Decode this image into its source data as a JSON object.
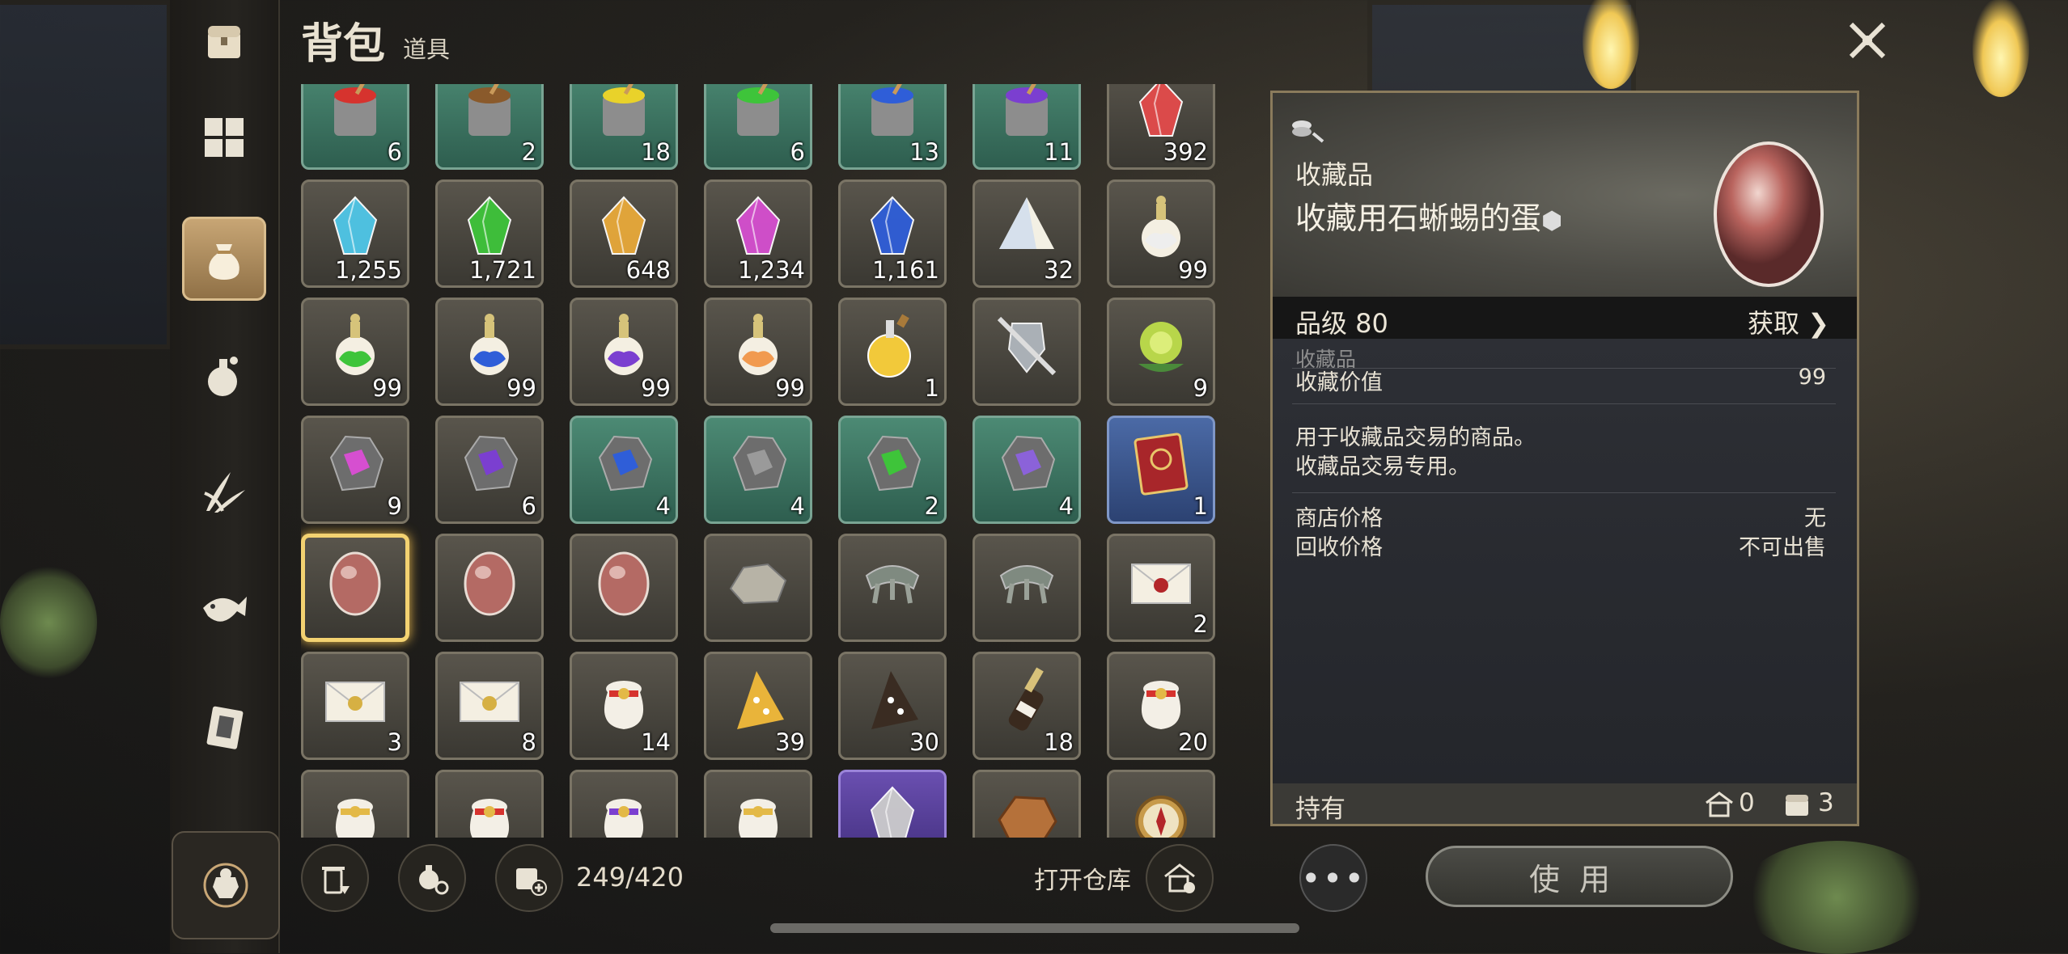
{
  "header": {
    "title": "背包",
    "subtitle": "道具"
  },
  "nav": [
    "chest-icon",
    "grid-icon",
    "bag-icon",
    "potion-icon",
    "herb-icon",
    "fish-icon",
    "book-icon",
    "armor-icon"
  ],
  "items": [
    {
      "icon": "red-paint-bucket",
      "qty": "6",
      "bg": "green"
    },
    {
      "icon": "brown-paint-bucket",
      "qty": "2",
      "bg": "green"
    },
    {
      "icon": "yellow-paint-bucket",
      "qty": "18",
      "bg": "green"
    },
    {
      "icon": "green-paint-bucket",
      "qty": "6",
      "bg": "green"
    },
    {
      "icon": "blue-paint-bucket",
      "qty": "13",
      "bg": "green"
    },
    {
      "icon": "purple-paint-bucket",
      "qty": "11",
      "bg": "green"
    },
    {
      "icon": "red-gem",
      "qty": "392",
      "bg": "gray"
    },
    {
      "icon": "cyan-crystal",
      "qty": "1,255",
      "bg": "gray"
    },
    {
      "icon": "green-crystal",
      "qty": "1,721",
      "bg": "gray"
    },
    {
      "icon": "amber-crystal",
      "qty": "648",
      "bg": "gray"
    },
    {
      "icon": "pink-crystal",
      "qty": "1,234",
      "bg": "gray"
    },
    {
      "icon": "blue-crystal",
      "qty": "1,161",
      "bg": "gray"
    },
    {
      "icon": "prism",
      "qty": "32",
      "bg": "gray"
    },
    {
      "icon": "white-perfume-bottle",
      "qty": "99",
      "bg": "gray"
    },
    {
      "icon": "green-perfume-bottle",
      "qty": "99",
      "bg": "gray"
    },
    {
      "icon": "blue-perfume-bottle",
      "qty": "99",
      "bg": "gray"
    },
    {
      "icon": "purple-perfume-bottle",
      "qty": "99",
      "bg": "gray"
    },
    {
      "icon": "orange-perfume-bottle",
      "qty": "99",
      "bg": "gray"
    },
    {
      "icon": "yellow-potion-flask",
      "qty": "1",
      "bg": "gray"
    },
    {
      "icon": "shield-and-sword",
      "qty": "",
      "bg": "gray"
    },
    {
      "icon": "green-rose",
      "qty": "9",
      "bg": "gray"
    },
    {
      "icon": "pink-ore",
      "qty": "9",
      "bg": "gray"
    },
    {
      "icon": "purple-ore",
      "qty": "6",
      "bg": "gray"
    },
    {
      "icon": "blue-ore",
      "qty": "4",
      "bg": "green"
    },
    {
      "icon": "gray-ore",
      "qty": "4",
      "bg": "green"
    },
    {
      "icon": "green-ore",
      "qty": "2",
      "bg": "green"
    },
    {
      "icon": "violet-ore",
      "qty": "4",
      "bg": "green"
    },
    {
      "icon": "red-book",
      "qty": "1",
      "bg": "blue"
    },
    {
      "icon": "stone-lizard-egg",
      "qty": "",
      "bg": "gray",
      "selected": true
    },
    {
      "icon": "stone-lizard-egg",
      "qty": "",
      "bg": "gray"
    },
    {
      "icon": "stone-lizard-egg",
      "qty": "",
      "bg": "gray"
    },
    {
      "icon": "gray-rock",
      "qty": "",
      "bg": "gray"
    },
    {
      "icon": "claw-relic",
      "qty": "",
      "bg": "gray"
    },
    {
      "icon": "claw-relic",
      "qty": "",
      "bg": "gray"
    },
    {
      "icon": "red-seal-letter",
      "qty": "2",
      "bg": "gray"
    },
    {
      "icon": "gold-seal-letter",
      "qty": "3",
      "bg": "gray"
    },
    {
      "icon": "gold-seal-letter",
      "qty": "8",
      "bg": "gray"
    },
    {
      "icon": "red-ribbon-pouch",
      "qty": "14",
      "bg": "gray"
    },
    {
      "icon": "yellow-party-hat",
      "qty": "39",
      "bg": "gray"
    },
    {
      "icon": "dark-party-hat",
      "qty": "30",
      "bg": "gray"
    },
    {
      "icon": "champagne-bottle",
      "qty": "18",
      "bg": "gray"
    },
    {
      "icon": "red-ribbon-pouch",
      "qty": "20",
      "bg": "gray"
    },
    {
      "icon": "gold-ribbon-pouch",
      "qty": "",
      "bg": "gray"
    },
    {
      "icon": "red-ribbon-pouch",
      "qty": "",
      "bg": "gray"
    },
    {
      "icon": "purple-ribbon-pouch",
      "qty": "",
      "bg": "gray"
    },
    {
      "icon": "gold-ribbon-pouch",
      "qty": "",
      "bg": "gray"
    },
    {
      "icon": "crystal-vase",
      "qty": "",
      "bg": "purple"
    },
    {
      "icon": "bronze-ore",
      "qty": "",
      "bg": "gray"
    },
    {
      "icon": "compass",
      "qty": "",
      "bg": "gray"
    }
  ],
  "bottom": {
    "capacity": "249/420",
    "open_warehouse": "打开仓库",
    "use_button": "使用",
    "more": "•••"
  },
  "detail": {
    "category": "收藏品",
    "name": "收藏用石蜥蜴的蛋",
    "grade": "品级 80",
    "acquire": "获取",
    "section_label": "收藏品",
    "collect_value_label": "收藏价值",
    "collect_value": "99",
    "desc_line1": "用于收藏品交易的商品。",
    "desc_line2": "收藏品交易专用。",
    "shop_price_label": "商店价格",
    "shop_price": "无",
    "recycle_price_label": "回收价格",
    "recycle_price": "不可出售",
    "hold_label": "持有",
    "hold_home": "0",
    "hold_bag": "3"
  },
  "colors": {
    "accent_gold": "#f3d271",
    "green_tile": "#4c8a74",
    "blue_tile": "#4b6aa6",
    "purple_tile": "#6a4fb0"
  }
}
